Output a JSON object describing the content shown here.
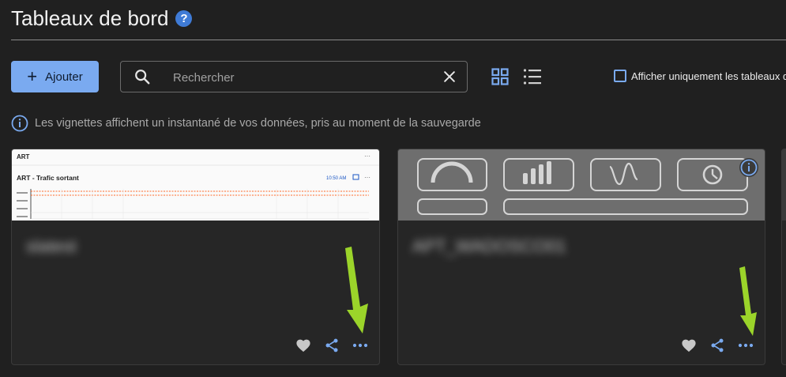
{
  "header": {
    "title": "Tableaux de bord",
    "help_glyph": "?"
  },
  "toolbar": {
    "add_label": "Ajouter",
    "search_placeholder": "Rechercher",
    "checkbox_label": "Afficher uniquement les tableaux d"
  },
  "info_text": "Les vignettes affichent un instantané de vos données, pris au moment de la sauvegarde",
  "cards": [
    {
      "name": "slatest",
      "thumb": {
        "header": "ART",
        "panel_title": "ART - Trafic sortant",
        "time": "10:50 AM"
      }
    },
    {
      "name": "APT_WADOSCO01"
    }
  ],
  "colors": {
    "accent": "#7aaaf0",
    "background": "#202020",
    "card": "#262626",
    "arrow": "#9bd42a",
    "info_badge": "#3f7bd6"
  },
  "icons": {
    "search": "search-icon",
    "clear": "close-icon",
    "grid_view": "grid-view-icon",
    "list_view": "list-view-icon",
    "favorite": "heart-icon",
    "share": "share-icon",
    "more": "more-icon",
    "info": "info-icon"
  }
}
